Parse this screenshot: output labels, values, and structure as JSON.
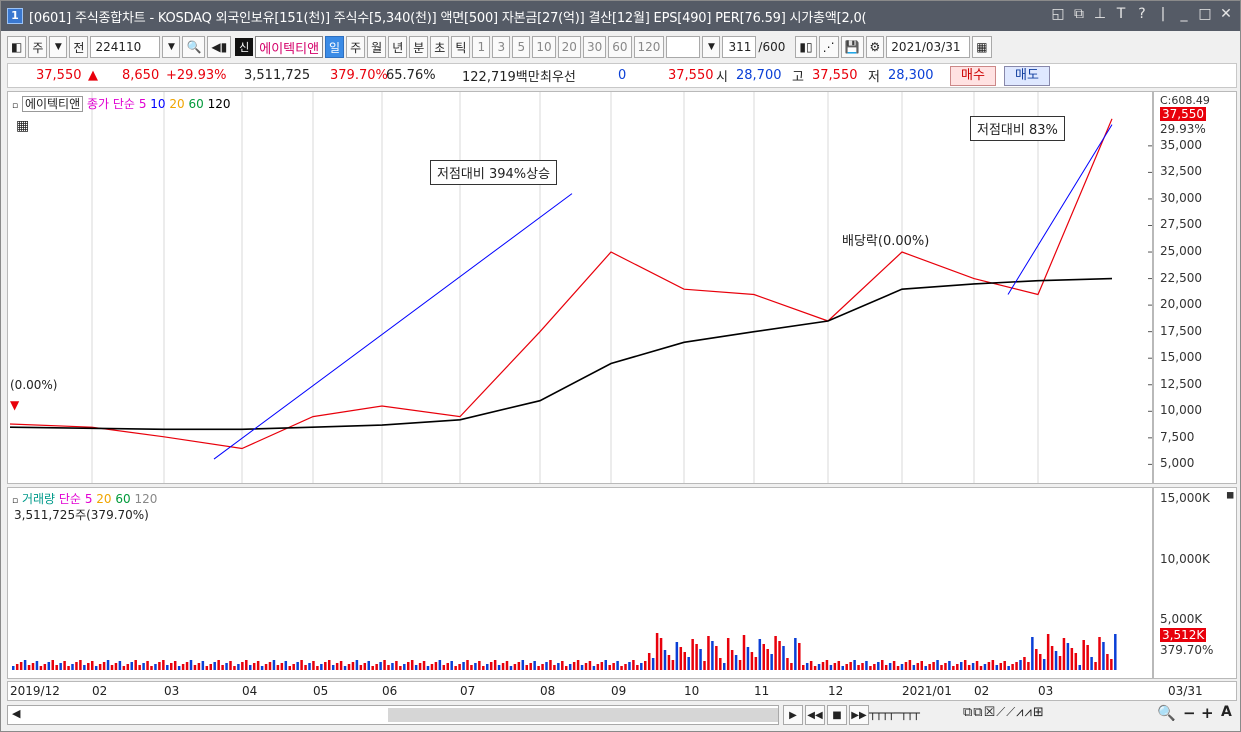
{
  "title": {
    "screen_number": "1",
    "text": "[0601] 주식종합차트 - KOSDAQ 외국인보유[151(천)] 주식수[5,340(천)] 액면[500] 자본금[27(억)] 결산[12월] EPS[490] PER[76.59] 시가총액[2,0("
  },
  "toolbar": {
    "period_type": "주",
    "prev_label": "전",
    "code": "224110",
    "new_badge": "신",
    "stock_name": "에이텍티앤",
    "periods": [
      "일",
      "주",
      "월",
      "년",
      "분",
      "초",
      "틱"
    ],
    "selected_period": "일",
    "minute_units": [
      "1",
      "3",
      "5",
      "10",
      "20",
      "30",
      "60",
      "120"
    ],
    "count": "311",
    "count_total": "/600",
    "date": "2021/03/31"
  },
  "quote": {
    "price": "37,550",
    "change": "8,650",
    "change_rate": "+29.93%",
    "volume": "3,511,725",
    "volume_rate": "379.70%",
    "ratio": "65.76%",
    "amount": "122,719백만",
    "priority_label": "최우선",
    "priority_value": "0",
    "last": "37,550",
    "open_label": "시",
    "open": "28,700",
    "high_label": "고",
    "high": "37,550",
    "low_label": "저",
    "low": "28,300",
    "buy": "매수",
    "sell": "매도"
  },
  "price_legend": {
    "name": "에이텍티앤",
    "close_label": "종가",
    "ma_type": "단순",
    "ma": [
      "5",
      "10",
      "20",
      "60",
      "120"
    ]
  },
  "price_axis": {
    "ticks": [
      "35,000",
      "32,500",
      "30,000",
      "27,500",
      "25,000",
      "22,500",
      "20,000",
      "17,500",
      "15,000",
      "12,500",
      "10,000",
      "7,500",
      "5,000"
    ],
    "max_label": "C:608.49",
    "current": "37,550",
    "current_rate": "29.93%"
  },
  "annotations": {
    "left_rate": "(0.00%)",
    "rise_note": "저점대비 394%상승",
    "rise_note2": "저점대비 83%",
    "dividend": "배당락(0.00%)"
  },
  "volume_legend": {
    "label": "거래량",
    "ma_type": "단순",
    "ma": [
      "5",
      "20",
      "60",
      "120"
    ],
    "current": "3,511,725주(379.70%)"
  },
  "volume_axis": {
    "ticks": [
      "15,000K",
      "10,000K",
      "5,000K"
    ],
    "current": "3,512K",
    "current_rate": "379.70%"
  },
  "x_axis": {
    "labels": [
      "2019/12",
      "02",
      "03",
      "04",
      "05",
      "06",
      "07",
      "08",
      "09",
      "10",
      "11",
      "12",
      "2021/01",
      "02",
      "03"
    ],
    "last": "03/31"
  },
  "colors": {
    "up": "#e8000b",
    "down": "#0a3fd6",
    "ma5": "#e100d2",
    "ma10": "#0000ff",
    "ma20": "#f0a500",
    "ma60": "#009a3a",
    "ma120": "#000000"
  },
  "chart_data": {
    "type": "line",
    "x": [
      "2019/12",
      "02",
      "03",
      "04",
      "05",
      "06",
      "07",
      "08",
      "09",
      "10",
      "11",
      "12",
      "2021/01",
      "02",
      "03",
      "03/31"
    ],
    "series": [
      {
        "name": "종가",
        "values": [
          8800,
          8500,
          7600,
          6500,
          9500,
          10500,
          9500,
          17500,
          25000,
          21500,
          21000,
          18500,
          25000,
          22500,
          21000,
          37550
        ]
      },
      {
        "name": "120",
        "values": [
          8500,
          8400,
          8300,
          8300,
          8500,
          8700,
          9200,
          11000,
          14500,
          16500,
          17500,
          18500,
          21500,
          22000,
          22300,
          22500
        ]
      }
    ],
    "ylim": [
      4000,
      38000
    ]
  }
}
